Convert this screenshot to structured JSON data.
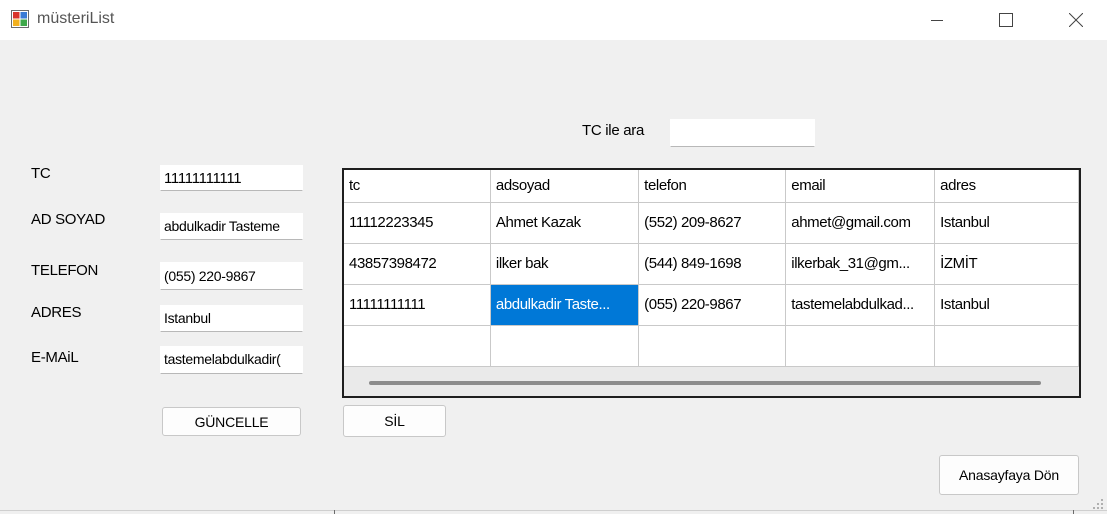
{
  "window": {
    "title": "müsteriList",
    "icons": {
      "app": "app-form-icon",
      "minimize": "minimize-icon",
      "maximize": "maximize-icon",
      "close": "close-icon"
    }
  },
  "search": {
    "label": "TC ile ara",
    "value": ""
  },
  "form": {
    "tc_label": "TC",
    "tc_value": "11111111111",
    "adsoyad_label": "AD SOYAD",
    "adsoyad_value": "abdulkadir Tasteme",
    "telefon_label": "TELEFON",
    "telefon_value": "(055) 220-9867",
    "adres_label": "ADRES",
    "adres_value": "Istanbul",
    "email_label": "E-MAiL",
    "email_value": "tastemelabdulkadir("
  },
  "buttons": {
    "guncelle": "GÜNCELLE",
    "sil": "SİL",
    "anasayfa": "Anasayfaya Dön"
  },
  "grid": {
    "columns": [
      "tc",
      "adsoyad",
      "telefon",
      "email",
      "adres"
    ],
    "rows": [
      [
        "11112223345",
        "Ahmet Kazak",
        "(552) 209-8627",
        "ahmet@gmail.com",
        "Istanbul"
      ],
      [
        "43857398472",
        "ilker bak",
        "(544) 849-1698",
        "ilkerbak_31@gm...",
        "İZMİT"
      ],
      [
        "11111111111",
        "abdulkadir Taste...",
        "(055) 220-9867",
        "tastemelabdulkad...",
        "Istanbul"
      ],
      [
        "",
        "",
        "",
        "",
        ""
      ]
    ]
  },
  "colors": {
    "selection": "#0078d7",
    "background": "#f0f0f0"
  }
}
